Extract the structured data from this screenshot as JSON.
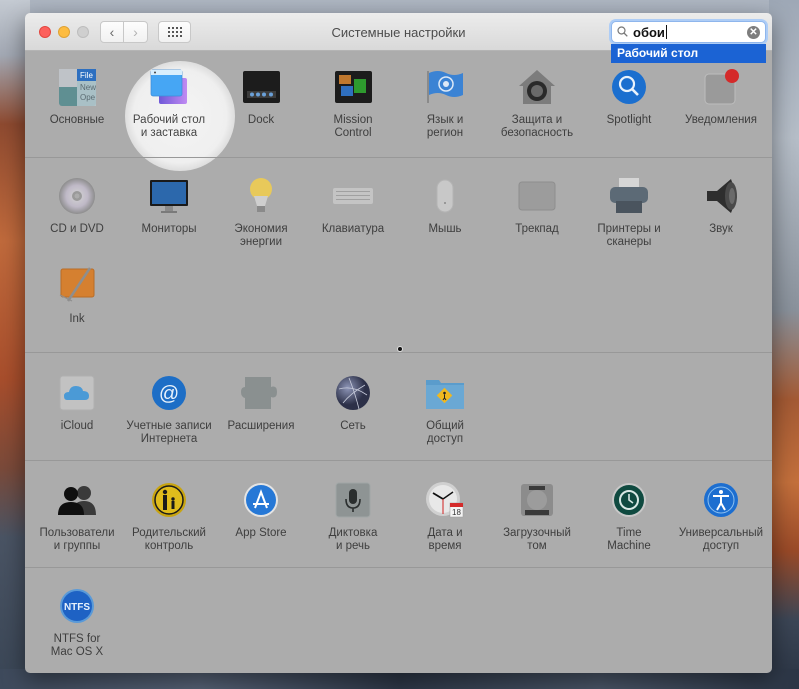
{
  "window": {
    "title": "Системные настройки",
    "nav": {
      "back_icon": "‹",
      "forward_icon": "›"
    }
  },
  "search": {
    "value": "обои",
    "suggestion": "Рабочий стол",
    "clear_icon": "✕"
  },
  "colors": {
    "accent": "#1b63d4",
    "window_bg": "#acacac",
    "highlight": "#efefef",
    "traffic_close": "#fc605c",
    "traffic_min": "#fdbc40"
  },
  "sections": [
    {
      "items": [
        {
          "id": "general",
          "label": "Основные",
          "icon": "general-icon"
        },
        {
          "id": "desktop",
          "label": "Рабочий стол\nи заставка",
          "icon": "desktop-screensaver-icon",
          "highlighted": true
        },
        {
          "id": "dock",
          "label": "Dock",
          "icon": "dock-icon"
        },
        {
          "id": "mission",
          "label": "Mission\nControl",
          "icon": "mission-control-icon"
        },
        {
          "id": "language",
          "label": "Язык и\nрегион",
          "icon": "language-region-icon"
        },
        {
          "id": "security",
          "label": "Защита и\nбезопасность",
          "icon": "security-icon"
        },
        {
          "id": "spotlight",
          "label": "Spotlight",
          "icon": "spotlight-icon"
        },
        {
          "id": "notifications",
          "label": "Уведомления",
          "icon": "notifications-icon"
        }
      ]
    },
    {
      "items": [
        {
          "id": "cd",
          "label": "CD и DVD",
          "icon": "cd-dvd-icon"
        },
        {
          "id": "displays",
          "label": "Мониторы",
          "icon": "displays-icon"
        },
        {
          "id": "energy",
          "label": "Экономия\nэнергии",
          "icon": "energy-saver-icon"
        },
        {
          "id": "keyboard",
          "label": "Клавиатура",
          "icon": "keyboard-icon"
        },
        {
          "id": "mouse",
          "label": "Мышь",
          "icon": "mouse-icon"
        },
        {
          "id": "trackpad",
          "label": "Трекпад",
          "icon": "trackpad-icon"
        },
        {
          "id": "printers",
          "label": "Принтеры и\nсканеры",
          "icon": "printers-scanners-icon"
        },
        {
          "id": "sound",
          "label": "Звук",
          "icon": "sound-icon"
        },
        {
          "id": "ink",
          "label": "Ink",
          "icon": "ink-icon"
        }
      ]
    },
    {
      "items": [
        {
          "id": "icloud",
          "label": "iCloud",
          "icon": "icloud-icon"
        },
        {
          "id": "internet",
          "label": "Учетные записи\nИнтернета",
          "icon": "internet-accounts-icon"
        },
        {
          "id": "extensions",
          "label": "Расширения",
          "icon": "extensions-icon"
        },
        {
          "id": "network",
          "label": "Сеть",
          "icon": "network-icon"
        },
        {
          "id": "sharing",
          "label": "Общий\nдоступ",
          "icon": "sharing-icon"
        }
      ]
    },
    {
      "items": [
        {
          "id": "users",
          "label": "Пользователи\nи группы",
          "icon": "users-groups-icon"
        },
        {
          "id": "parental",
          "label": "Родительский\nконтроль",
          "icon": "parental-controls-icon"
        },
        {
          "id": "appstore",
          "label": "App Store",
          "icon": "app-store-icon"
        },
        {
          "id": "dictation",
          "label": "Диктовка\nи речь",
          "icon": "dictation-speech-icon"
        },
        {
          "id": "datetime",
          "label": "Дата и\nвремя",
          "icon": "date-time-icon",
          "calendar_day": "18"
        },
        {
          "id": "startup",
          "label": "Загрузочный\nтом",
          "icon": "startup-disk-icon"
        },
        {
          "id": "timemachine",
          "label": "Time\nMachine",
          "icon": "time-machine-icon"
        },
        {
          "id": "accessibility",
          "label": "Универсальный\nдоступ",
          "icon": "accessibility-icon"
        }
      ]
    },
    {
      "items": [
        {
          "id": "ntfs",
          "label": "NTFS for\nMac OS X",
          "icon": "ntfs-icon",
          "badge_text": "NTFS"
        }
      ]
    }
  ],
  "icon_text": {
    "general_lines": [
      "File",
      "New",
      "Ope"
    ]
  }
}
